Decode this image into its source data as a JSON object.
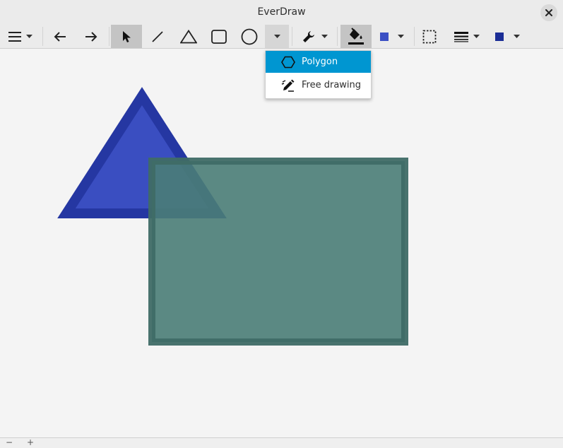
{
  "app": {
    "title": "EverDraw"
  },
  "titlebar": {
    "close_icon": "close-icon"
  },
  "toolbar": {
    "items": [
      {
        "name": "menu-button",
        "icon": "hamburger-icon"
      },
      {
        "name": "undo-button",
        "icon": "arrow-left-icon"
      },
      {
        "name": "redo-button",
        "icon": "arrow-right-icon"
      },
      {
        "name": "select-tool",
        "icon": "pointer-icon",
        "active": true
      },
      {
        "name": "line-tool",
        "icon": "line-icon"
      },
      {
        "name": "triangle-tool",
        "icon": "triangle-icon"
      },
      {
        "name": "rectangle-tool",
        "icon": "rectangle-icon"
      },
      {
        "name": "circle-tool",
        "icon": "circle-icon"
      },
      {
        "name": "more-shapes-dropdown",
        "icon": "chevron-down-icon",
        "open": true
      },
      {
        "name": "tools-button",
        "icon": "wrench-icon"
      },
      {
        "name": "fill-tool",
        "icon": "paint-bucket-icon",
        "active": true
      },
      {
        "name": "fill-color-picker",
        "icon": "color-swatch-icon"
      },
      {
        "name": "selection-options",
        "icon": "dashed-rectangle-icon"
      },
      {
        "name": "line-width-picker",
        "icon": "line-width-icon"
      },
      {
        "name": "stroke-color-picker",
        "icon": "color-swatch-icon"
      }
    ]
  },
  "colors": {
    "fill_swatch": "#3a4fc4",
    "stroke_swatch": "#1b2d96",
    "menu_highlight": "#0096d1",
    "triangle_fill": "#3549c0",
    "triangle_stroke": "#1f31a0",
    "rectangle_fill": "#4a7d77",
    "rectangle_stroke": "#3f6b66"
  },
  "shapes_menu": {
    "items": [
      {
        "label": "Polygon",
        "icon": "hexagon-icon",
        "selected": true
      },
      {
        "label": "Free drawing",
        "icon": "pencil-icon",
        "selected": false
      }
    ]
  },
  "canvas": {
    "shapes": [
      {
        "type": "triangle"
      },
      {
        "type": "rectangle"
      }
    ]
  },
  "statusbar": {
    "zoom_out_label": "−",
    "zoom_in_label": "+"
  }
}
